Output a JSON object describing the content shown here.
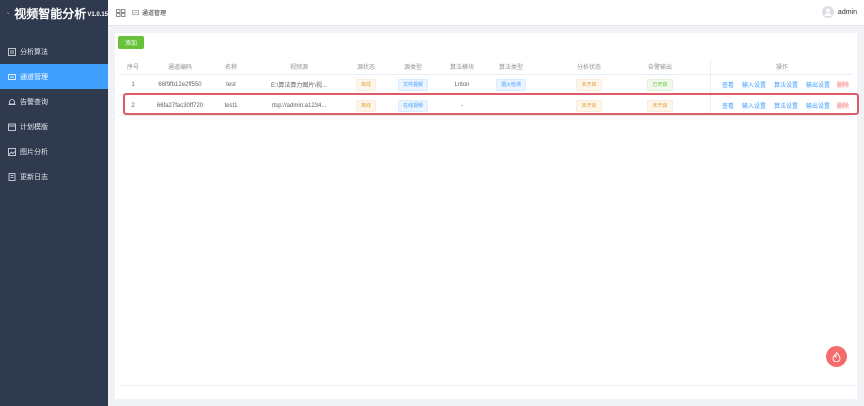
{
  "sidebar": {
    "brand": {
      "title": "视频智能分析",
      "version": "V1.0.15",
      "icon": "pulse-icon"
    },
    "items": [
      {
        "label": "分析算法",
        "icon": "algorithm-icon",
        "active": false
      },
      {
        "label": "通道管理",
        "icon": "channel-icon",
        "active": true
      },
      {
        "label": "告警查询",
        "icon": "alarm-icon",
        "active": false
      },
      {
        "label": "计划模版",
        "icon": "plan-icon",
        "active": false
      },
      {
        "label": "图片分析",
        "icon": "image-icon",
        "active": false
      },
      {
        "label": "更新日志",
        "icon": "log-icon",
        "active": false
      }
    ]
  },
  "header": {
    "breadcrumb": "通道管理",
    "user": {
      "name": "admin",
      "avatar_icon": "user-avatar-icon"
    }
  },
  "toolbar": {
    "add_label": "添加"
  },
  "table": {
    "columns": [
      "序号",
      "通道编码",
      "名称",
      "视频源",
      "源状态",
      "源类型",
      "算法模块",
      "算法类型",
      "分析状态",
      "告警输出",
      "操作"
    ],
    "rows": [
      {
        "index": "1",
        "code": "66f9fb12e2ff550",
        "name": "test",
        "source": "E:\\算法算力图片\\视...",
        "source_status": "离线",
        "source_type": "文件视频",
        "algo_module": "Lnton",
        "algo_type": "烟火检测",
        "analysis_status": "未开启",
        "alarm_output": "已开启",
        "actions": [
          "查看",
          "输入设置",
          "算法设置",
          "输出设置",
          "删除"
        ]
      },
      {
        "index": "2",
        "code": "66fa27fac30ff720",
        "name": "test1",
        "source": "rtsp://admin:a1234...",
        "source_status": "离线",
        "source_type": "在线视频",
        "algo_module": "-",
        "algo_type": "",
        "analysis_status": "未开启",
        "alarm_output": "未开启",
        "actions": [
          "查看",
          "输入设置",
          "算法设置",
          "输出设置",
          "删除"
        ]
      }
    ]
  },
  "colors": {
    "sidebar_bg": "#2f3a4f",
    "accent": "#409eff",
    "success": "#67c23a",
    "warning": "#e6a23c",
    "danger": "#f56c6c",
    "highlight_border": "#e05b6a"
  },
  "floating_button": {
    "icon": "flame-icon"
  }
}
